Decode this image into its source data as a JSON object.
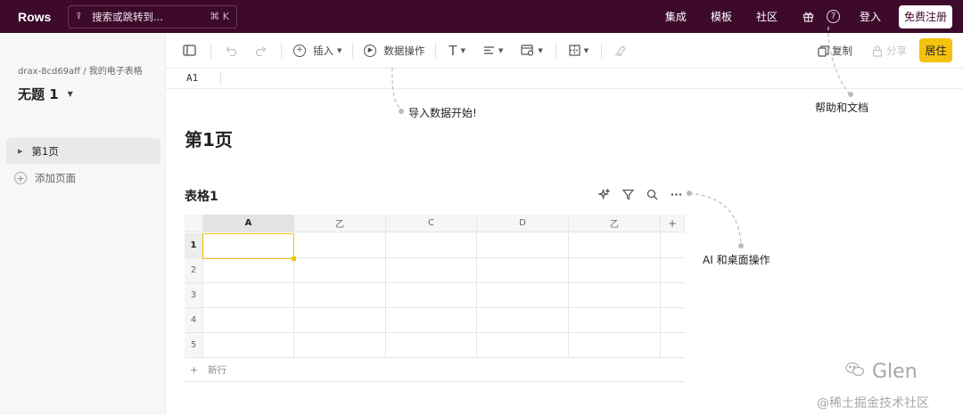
{
  "topbar": {
    "logo": "Rows",
    "search_placeholder": "搜索或跳转到...",
    "search_shortcut": "⌘ K",
    "nav": [
      "集成",
      "模板",
      "社区"
    ],
    "login": "登入",
    "signup": "免费注册",
    "bg_color": "#3d0a2b"
  },
  "sidebar": {
    "breadcrumb": "drax-8cd69aff / 我的电子表格",
    "doc_title": "无题 1",
    "pages": [
      "第1页"
    ],
    "add_page": "添加页面"
  },
  "toolbar": {
    "insert": "插入",
    "data_ops": "数据操作",
    "copy": "复制",
    "share": "分享",
    "live": "居住",
    "accent_color": "#f4c20d"
  },
  "formula_bar": {
    "cell_ref": "A1"
  },
  "content": {
    "page_heading": "第1页",
    "table_title": "表格1",
    "columns": [
      "A",
      "乙",
      "C",
      "D",
      "乙"
    ],
    "add_column": "+",
    "rows": [
      "1",
      "2",
      "3",
      "4",
      "5"
    ],
    "new_row": "新行",
    "selected_cell": "A1"
  },
  "annotations": {
    "import_data": "导入数据开始!",
    "help_docs": "帮助和文档",
    "ai_actions": "AI 和桌面操作"
  },
  "watermark": {
    "author": "Glen",
    "site": "@稀土掘金技术社区"
  }
}
